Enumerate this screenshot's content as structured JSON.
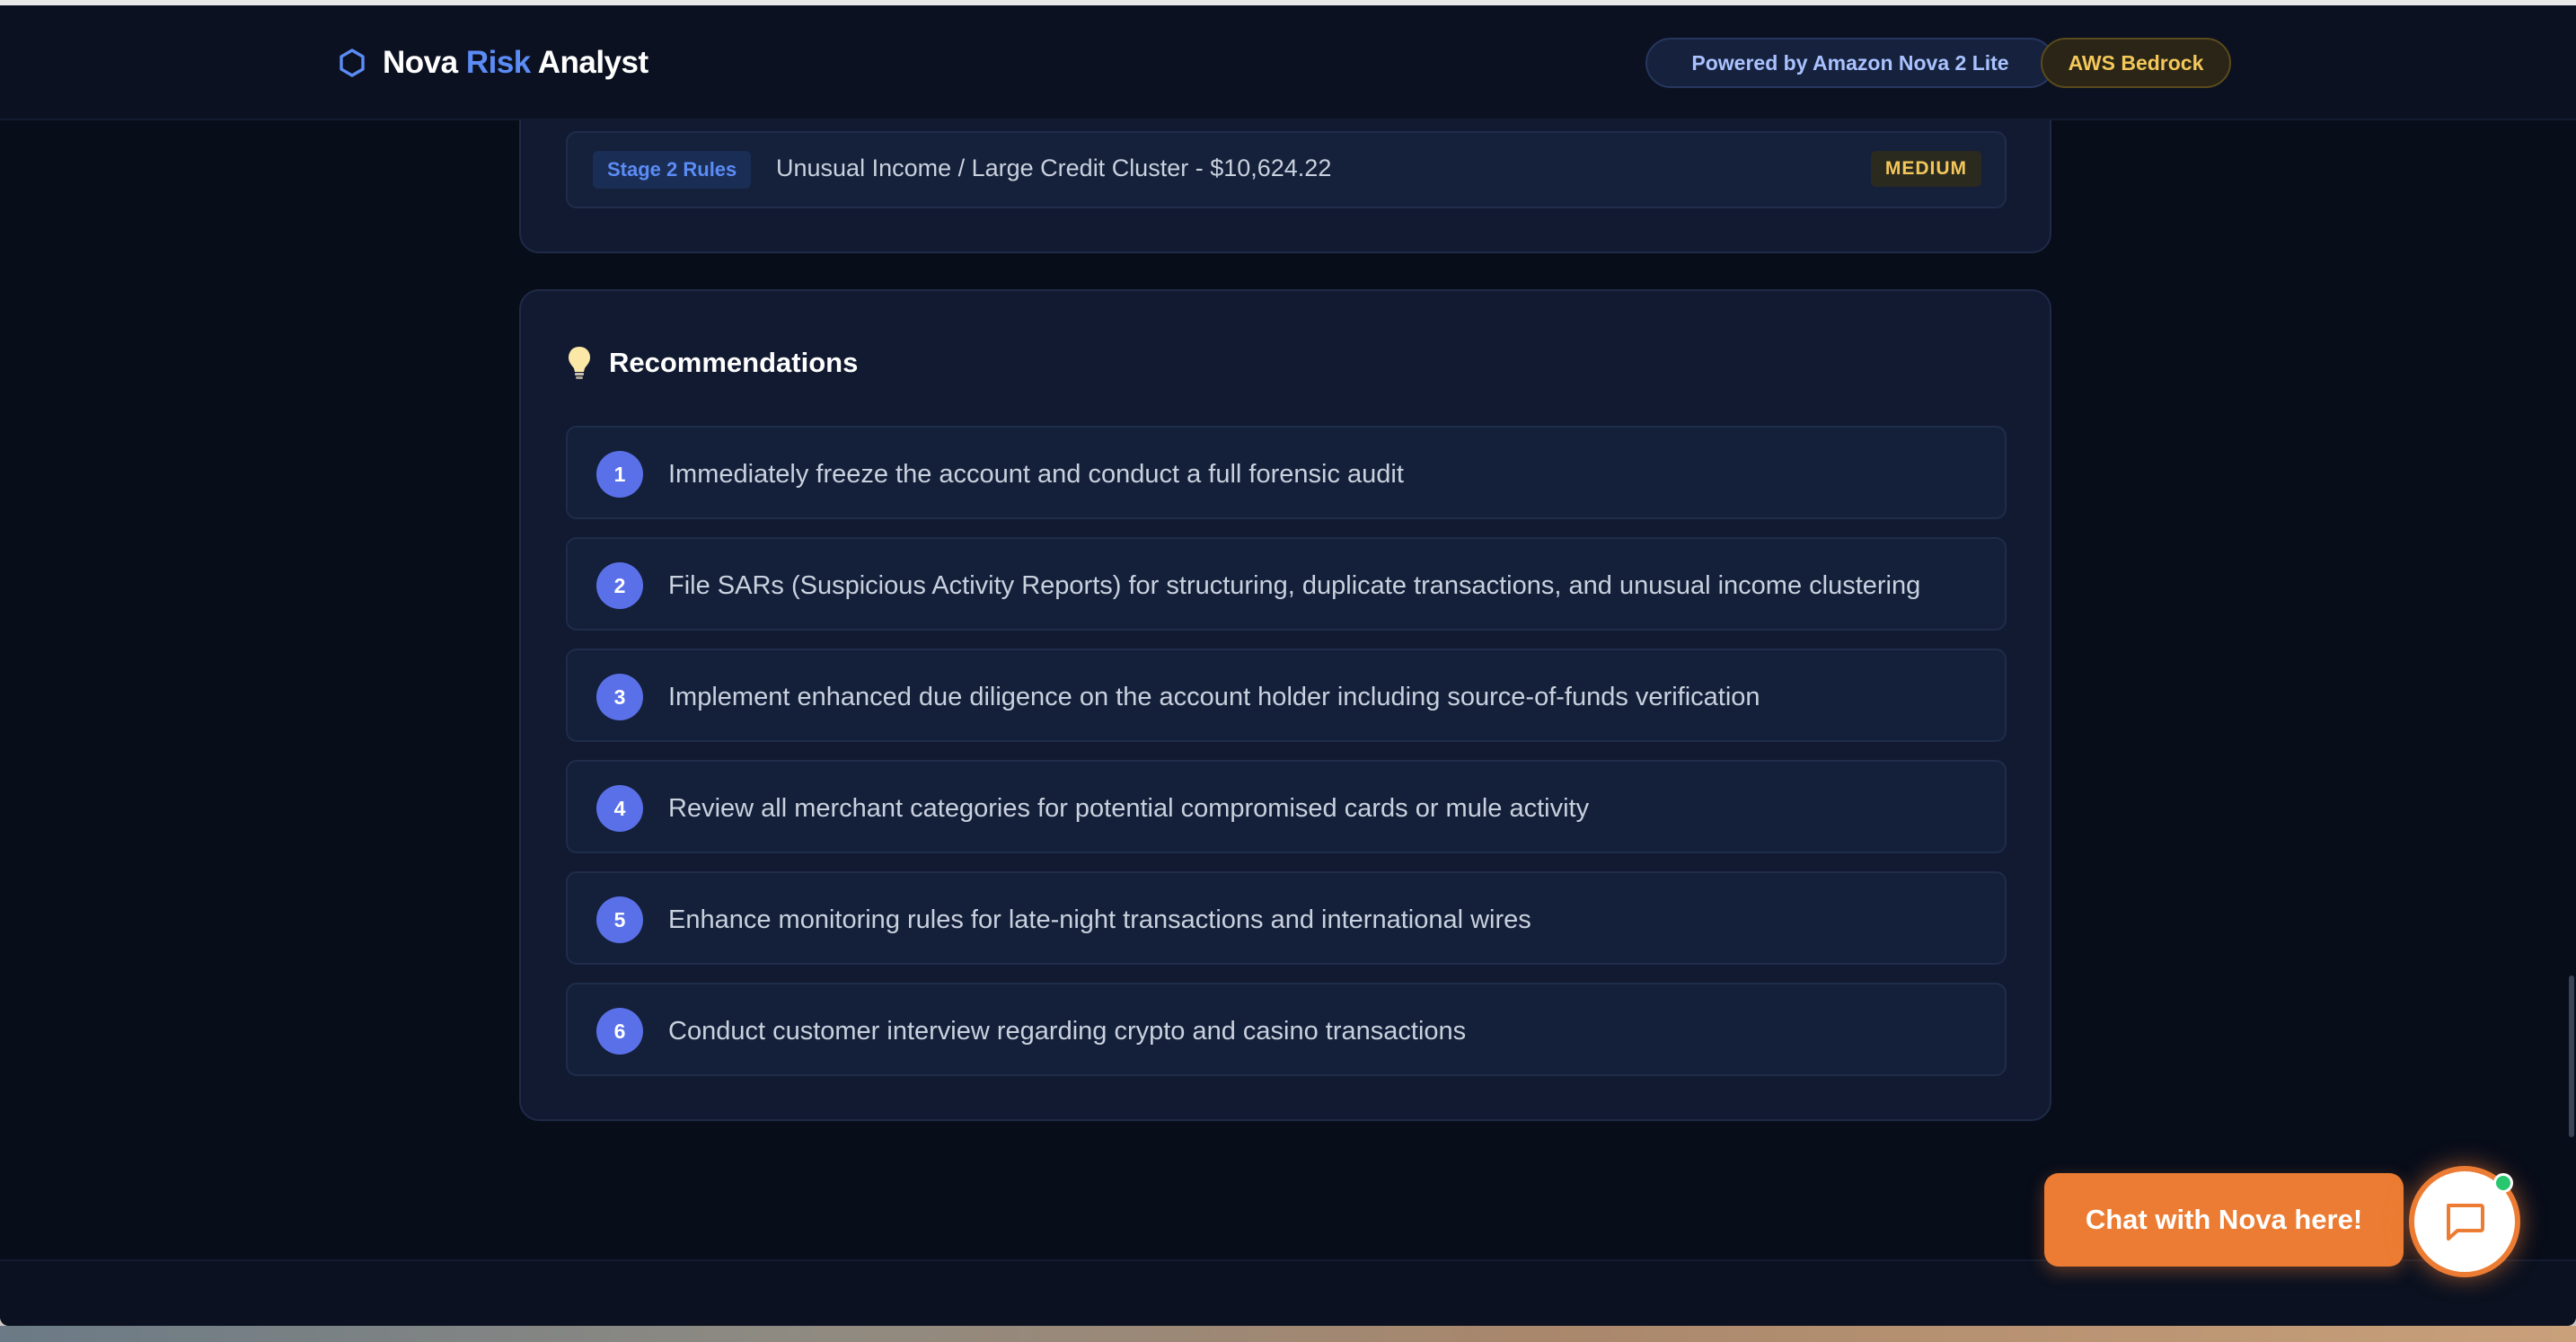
{
  "header": {
    "brand_name_1": "Nova",
    "brand_name_2": "Risk",
    "brand_name_3": "Analyst",
    "brand_icon": "hexagon-icon",
    "pill_model": "Powered by Amazon Nova 2 Lite",
    "pill_platform": "AWS Bedrock"
  },
  "rules": {
    "stage_label": "Stage 2 Rules",
    "text": "Unusual Income / Large Credit Cluster - $10,624.22",
    "severity": "MEDIUM"
  },
  "recommendations": {
    "icon": "lightbulb-icon",
    "title": "Recommendations",
    "items": [
      {
        "num": "1",
        "text": "Immediately freeze the account and conduct a full forensic audit"
      },
      {
        "num": "2",
        "text": "File SARs (Suspicious Activity Reports) for structuring, duplicate transactions, and unusual income clustering"
      },
      {
        "num": "3",
        "text": "Implement enhanced due diligence on the account holder including source-of-funds verification"
      },
      {
        "num": "4",
        "text": "Review all merchant categories for potential compromised cards or mule activity"
      },
      {
        "num": "5",
        "text": "Enhance monitoring rules for late-night transactions and international wires"
      },
      {
        "num": "6",
        "text": "Conduct customer interview regarding crypto and casino transactions"
      }
    ]
  },
  "chat": {
    "label": "Chat with Nova here!",
    "icon": "chat-bubble-icon"
  },
  "colors": {
    "background": "#080d1a",
    "accent_blue": "#5b8cf5",
    "accent_orange": "#ec7c33",
    "medium_yellow": "#f3c75a",
    "online_green": "#28c76f"
  }
}
